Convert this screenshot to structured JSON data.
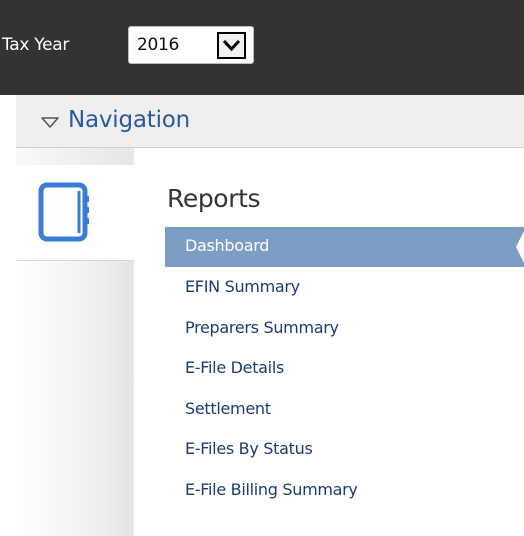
{
  "toolbar": {
    "tax_year_label": "Tax Year",
    "tax_year_value": "2016"
  },
  "navigation": {
    "title": "Navigation",
    "rail_icon": "notebook-icon"
  },
  "reports": {
    "title": "Reports",
    "items": [
      {
        "label": "Dashboard",
        "active": true
      },
      {
        "label": "EFIN Summary",
        "active": false
      },
      {
        "label": "Preparers Summary",
        "active": false
      },
      {
        "label": "E-File Details",
        "active": false
      },
      {
        "label": "Settlement",
        "active": false
      },
      {
        "label": "E-Files By Status",
        "active": false
      },
      {
        "label": "E-File Billing Summary",
        "active": false
      }
    ]
  },
  "colors": {
    "topbar": "#333333",
    "nav_title": "#2c5aa0",
    "active_item_bg": "#7e9dc4",
    "link_text": "#1c3b71",
    "icon_blue": "#3a7bd5"
  }
}
